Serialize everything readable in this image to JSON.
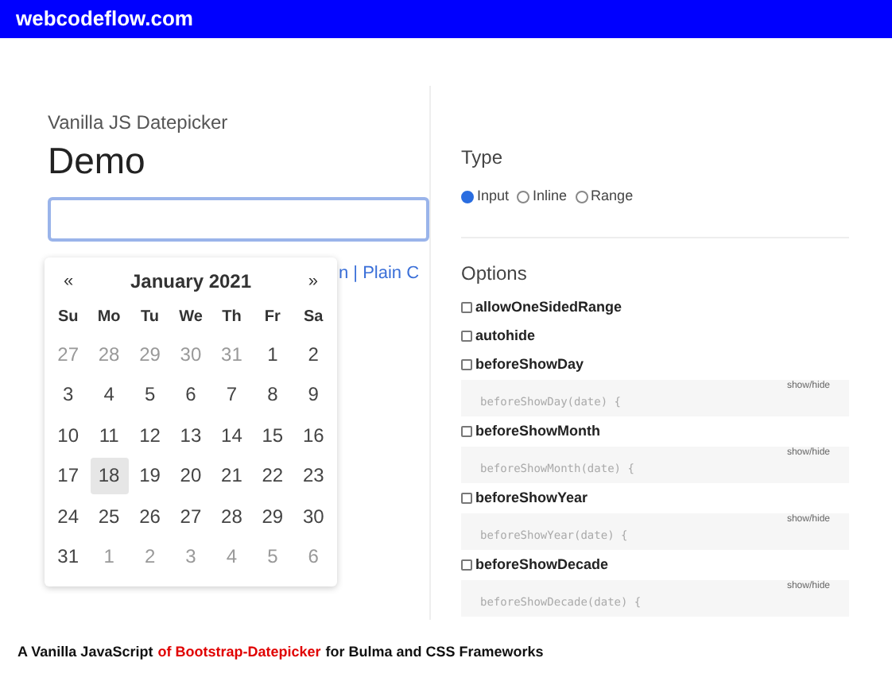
{
  "banner": {
    "title": "webcodeflow.com"
  },
  "demo": {
    "subtitle": "Vanilla JS Datepicker",
    "title": "Demo",
    "links": "n | Plain C"
  },
  "calendar": {
    "prev": "«",
    "title": "January 2021",
    "next": "»",
    "weekdays": [
      "Su",
      "Mo",
      "Tu",
      "We",
      "Th",
      "Fr",
      "Sa"
    ],
    "weeks": [
      [
        {
          "day": "27",
          "muted": true,
          "selected": false
        },
        {
          "day": "28",
          "muted": true,
          "selected": false
        },
        {
          "day": "29",
          "muted": true,
          "selected": false
        },
        {
          "day": "30",
          "muted": true,
          "selected": false
        },
        {
          "day": "31",
          "muted": true,
          "selected": false
        },
        {
          "day": "1",
          "muted": false,
          "selected": false
        },
        {
          "day": "2",
          "muted": false,
          "selected": false
        }
      ],
      [
        {
          "day": "3",
          "muted": false,
          "selected": false
        },
        {
          "day": "4",
          "muted": false,
          "selected": false
        },
        {
          "day": "5",
          "muted": false,
          "selected": false
        },
        {
          "day": "6",
          "muted": false,
          "selected": false
        },
        {
          "day": "7",
          "muted": false,
          "selected": false
        },
        {
          "day": "8",
          "muted": false,
          "selected": false
        },
        {
          "day": "9",
          "muted": false,
          "selected": false
        }
      ],
      [
        {
          "day": "10",
          "muted": false,
          "selected": false
        },
        {
          "day": "11",
          "muted": false,
          "selected": false
        },
        {
          "day": "12",
          "muted": false,
          "selected": false
        },
        {
          "day": "13",
          "muted": false,
          "selected": false
        },
        {
          "day": "14",
          "muted": false,
          "selected": false
        },
        {
          "day": "15",
          "muted": false,
          "selected": false
        },
        {
          "day": "16",
          "muted": false,
          "selected": false
        }
      ],
      [
        {
          "day": "17",
          "muted": false,
          "selected": false
        },
        {
          "day": "18",
          "muted": false,
          "selected": true
        },
        {
          "day": "19",
          "muted": false,
          "selected": false
        },
        {
          "day": "20",
          "muted": false,
          "selected": false
        },
        {
          "day": "21",
          "muted": false,
          "selected": false
        },
        {
          "day": "22",
          "muted": false,
          "selected": false
        },
        {
          "day": "23",
          "muted": false,
          "selected": false
        }
      ],
      [
        {
          "day": "24",
          "muted": false,
          "selected": false
        },
        {
          "day": "25",
          "muted": false,
          "selected": false
        },
        {
          "day": "26",
          "muted": false,
          "selected": false
        },
        {
          "day": "27",
          "muted": false,
          "selected": false
        },
        {
          "day": "28",
          "muted": false,
          "selected": false
        },
        {
          "day": "29",
          "muted": false,
          "selected": false
        },
        {
          "day": "30",
          "muted": false,
          "selected": false
        }
      ],
      [
        {
          "day": "31",
          "muted": false,
          "selected": false
        },
        {
          "day": "1",
          "muted": true,
          "selected": false
        },
        {
          "day": "2",
          "muted": true,
          "selected": false
        },
        {
          "day": "3",
          "muted": true,
          "selected": false
        },
        {
          "day": "4",
          "muted": true,
          "selected": false
        },
        {
          "day": "5",
          "muted": true,
          "selected": false
        },
        {
          "day": "6",
          "muted": true,
          "selected": false
        }
      ]
    ]
  },
  "type": {
    "heading": "Type",
    "options": [
      {
        "label": "Input",
        "selected": true
      },
      {
        "label": "Inline",
        "selected": false
      },
      {
        "label": "Range",
        "selected": false
      }
    ]
  },
  "options": {
    "heading": "Options",
    "items": [
      {
        "label": "allowOneSidedRange",
        "checked": false
      },
      {
        "label": "autohide",
        "checked": false
      },
      {
        "label": "beforeShowDay",
        "checked": false,
        "toggle": "show/hide",
        "code": "beforeShowDay(date) {"
      },
      {
        "label": "beforeShowMonth",
        "checked": false,
        "toggle": "show/hide",
        "code": "beforeShowMonth(date) {"
      },
      {
        "label": "beforeShowYear",
        "checked": false,
        "toggle": "show/hide",
        "code": "beforeShowYear(date) {"
      },
      {
        "label": "beforeShowDecade",
        "checked": false,
        "toggle": "show/hide",
        "code": "beforeShowDecade(date) {"
      }
    ]
  },
  "caption": [
    {
      "text": "A Vanilla JavaScript",
      "color": "#111111"
    },
    {
      "text": "of Bootstrap-Datepicker",
      "color": "#e00000"
    },
    {
      "text": "for Bulma and CSS Frameworks",
      "color": "#111111"
    }
  ]
}
